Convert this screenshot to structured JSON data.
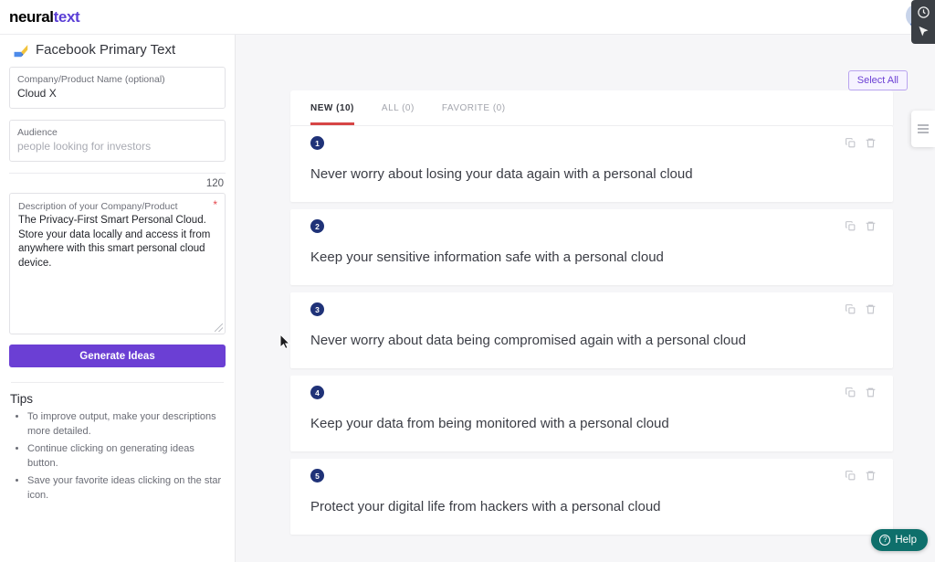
{
  "brand": {
    "part1": "neural",
    "part2": "text"
  },
  "topbar": {
    "avatar_name": "user-avatar"
  },
  "capture_toolbar": {
    "clock_icon": "clock-icon",
    "cursor_icon": "cursor-arrow-icon"
  },
  "sidebar": {
    "panel_title": "Facebook Primary Text",
    "panel_icon": "facebook-primary-text-icon",
    "company_field": {
      "label": "Company/Product Name (optional)",
      "value": "Cloud X"
    },
    "audience_field": {
      "label": "Audience",
      "placeholder": "people looking for investors",
      "value": ""
    },
    "char_counter": "120",
    "description_field": {
      "label": "Description of your Company/Product",
      "required_marker": "*",
      "value": "The Privacy-First Smart Personal Cloud. Store your data locally and access it from anywhere with this smart personal cloud device."
    },
    "generate_button": "Generate Ideas",
    "tips_title": "Tips",
    "tips": [
      "To improve output, make your descriptions more detailed.",
      "Continue clicking on generating ideas button.",
      "Save your favorite ideas clicking on the star icon."
    ]
  },
  "main": {
    "select_all_label": "Select All",
    "tabs": [
      {
        "label": "NEW (10)",
        "active": true
      },
      {
        "label": "ALL (0)",
        "active": false
      },
      {
        "label": "FAVORITE (0)",
        "active": false
      }
    ],
    "ideas": [
      {
        "number": "1",
        "text": "Never worry about losing your data again with a personal cloud"
      },
      {
        "number": "2",
        "text": "Keep your sensitive information safe with a personal cloud"
      },
      {
        "number": "3",
        "text": "Never worry about data being compromised again with a personal cloud"
      },
      {
        "number": "4",
        "text": "Keep your data from being monitored with a personal cloud"
      },
      {
        "number": "5",
        "text": "Protect your digital life from hackers with a personal cloud"
      }
    ],
    "card_actions": {
      "copy": "copy-icon",
      "delete": "trash-icon"
    }
  },
  "edge_menu": {
    "icon": "hamburger-menu-icon"
  },
  "help_widget": {
    "label": "Help",
    "icon": "question-mark-icon"
  },
  "colors": {
    "brand_purple": "#6b3fd4",
    "accent_red": "#d64545",
    "badge_navy": "#1f3278",
    "help_teal": "#0e6f6b",
    "required_red": "#e5484d"
  }
}
